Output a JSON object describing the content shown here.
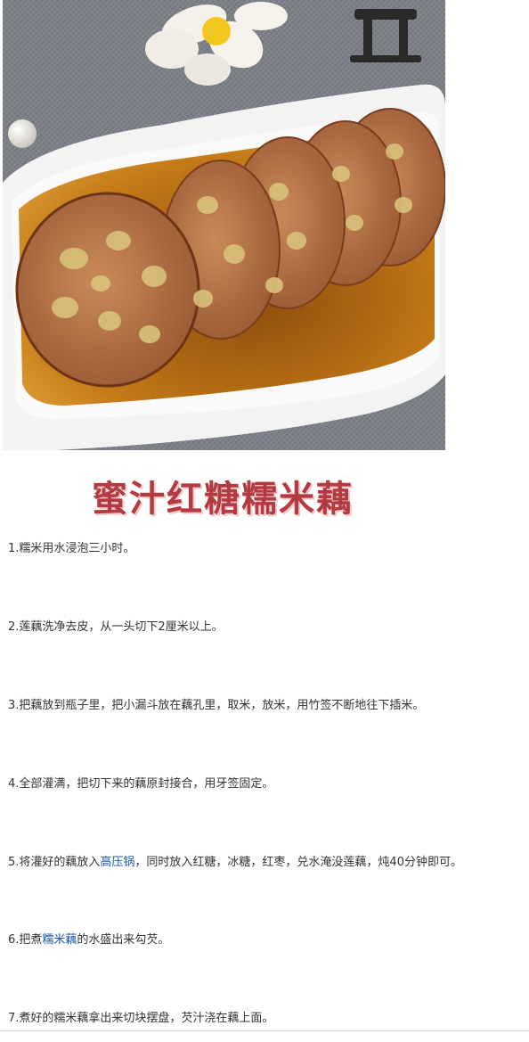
{
  "recipe_title": "蜜汁红糖糯米藕",
  "colors": {
    "title": "#b23a40",
    "link": "#1f57a8",
    "text": "#333333"
  },
  "steps": [
    {
      "text": "1.糯米用水浸泡三小时。"
    },
    {
      "text": "2.莲藕洗净去皮，从一头切下2厘米以上。"
    },
    {
      "text": "3.把藕放到瓶子里，把小漏斗放在藕孔里，取米，放米，用竹签不断地往下插米。"
    },
    {
      "text": "4.全部灌满，把切下来的藕原封接合，用牙签固定。"
    },
    {
      "before": "5.将灌好的藕放入",
      "link": "高压锅",
      "after": "，同时放入红糖，冰糖，红枣，兑水淹没莲藕，炖40分钟即可。"
    },
    {
      "before": "6.把煮",
      "link": "糯米藕",
      "after": "的水盛出来勾芡。"
    },
    {
      "text": "7.煮好的糯米藕拿出来切块摆盘，芡汁浇在藕上面。"
    }
  ]
}
